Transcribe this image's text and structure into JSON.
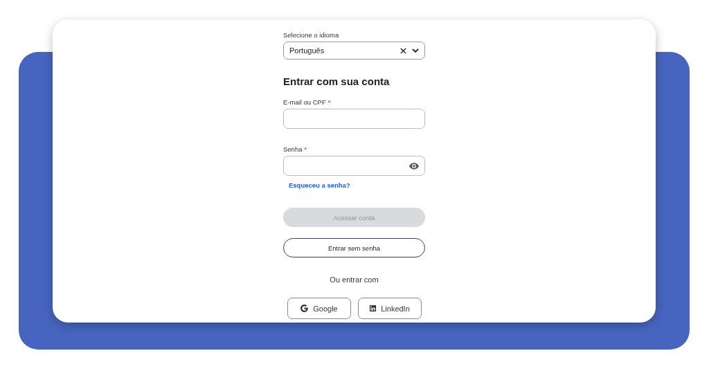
{
  "language": {
    "label": "Selecione o idioma",
    "value": "Português"
  },
  "heading": "Entrar com sua conta",
  "fields": [
    {
      "label": "E-mail ou CPF",
      "required_mark": "*",
      "kind": "text"
    },
    {
      "label": "Senha",
      "required_mark": "*",
      "kind": "password"
    }
  ],
  "forgot_link": "Esqueceu a senha?",
  "buttons": [
    {
      "label": "Acessar conta",
      "disabled": true,
      "kind": "primary"
    },
    {
      "label": "Entrar sem senha",
      "disabled": false,
      "kind": "outline"
    }
  ],
  "divider_text": "Ou entrar com",
  "social": [
    {
      "label": "Google",
      "kind": "google"
    },
    {
      "label": "LinkedIn",
      "kind": "linkedin"
    }
  ]
}
